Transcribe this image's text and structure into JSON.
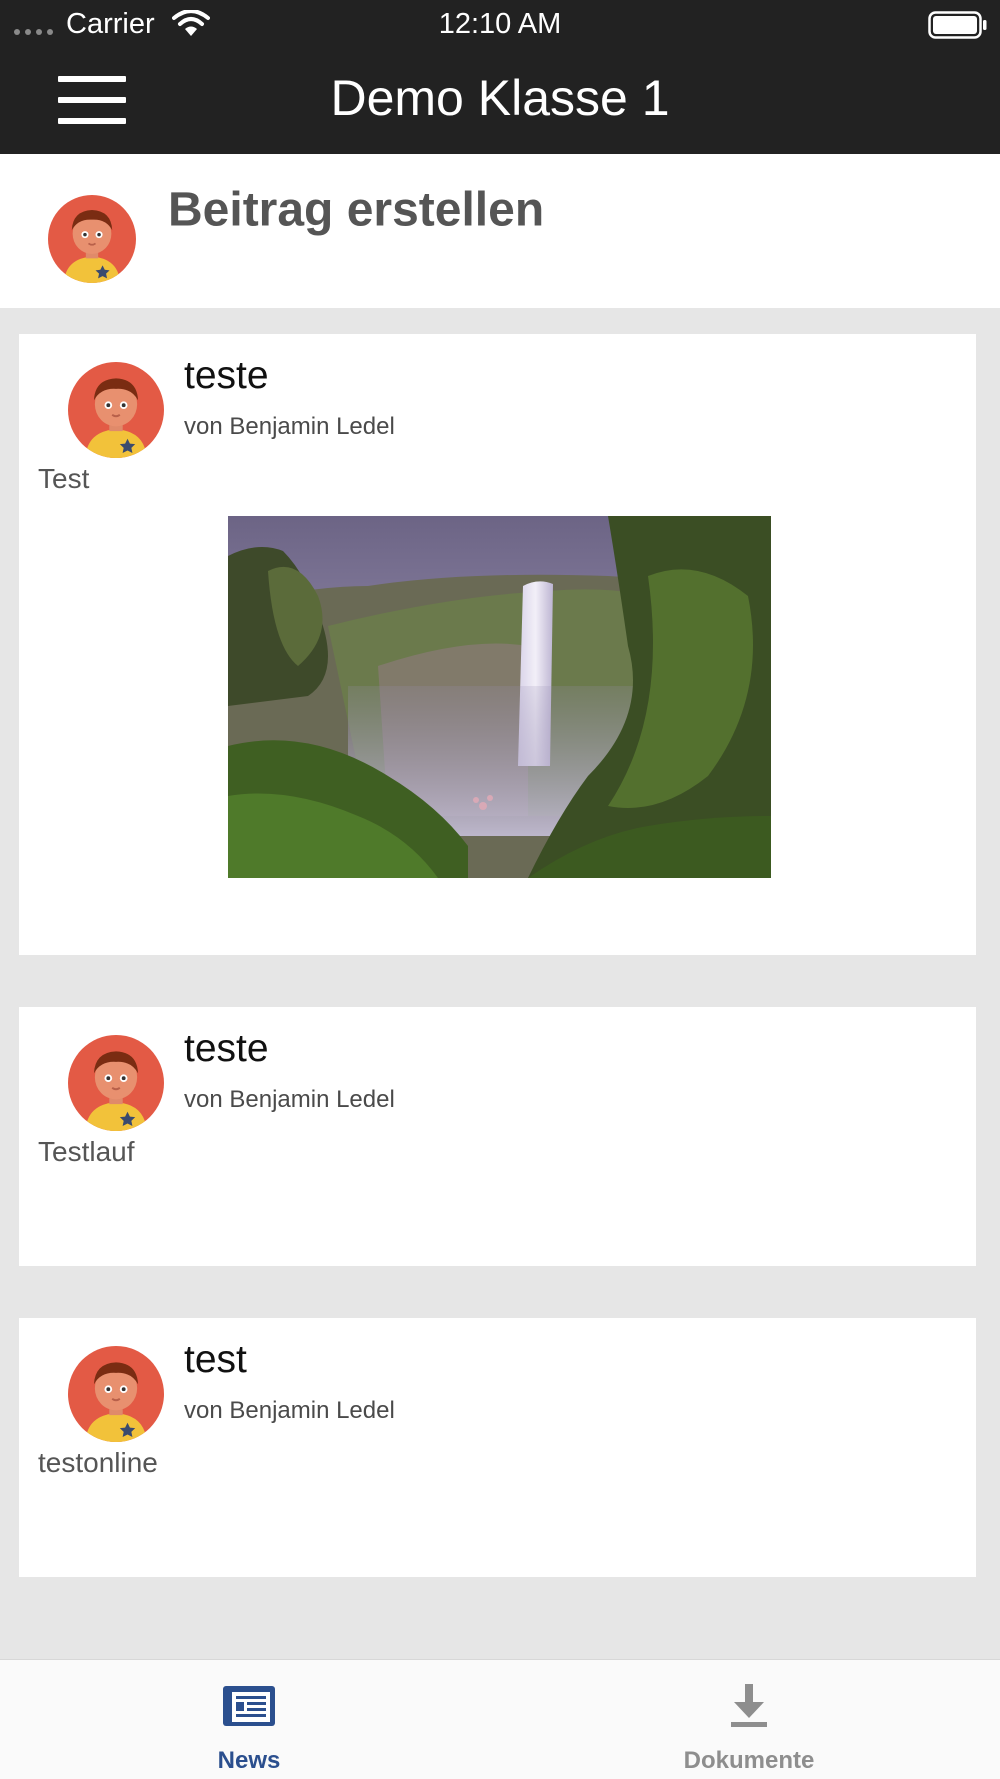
{
  "status_bar": {
    "carrier": "Carrier",
    "time": "12:10 AM"
  },
  "nav_bar": {
    "title": "Demo Klasse 1",
    "menu_icon": "hamburger-menu-icon"
  },
  "create_post": {
    "label": "Beitrag erstellen"
  },
  "posts": [
    {
      "title": "teste",
      "author": "von Benjamin Ledel",
      "body": "Test",
      "has_image": true,
      "image_subject": "waterfall photo"
    },
    {
      "title": "teste",
      "author": "von Benjamin Ledel",
      "body": "Testlauf",
      "has_image": false
    },
    {
      "title": "test",
      "author": "von Benjamin Ledel",
      "body": "testonline",
      "has_image": false
    }
  ],
  "tabs": [
    {
      "label": "News",
      "icon": "newspaper-icon",
      "active": true
    },
    {
      "label": "Dokumente",
      "icon": "download-icon",
      "active": false
    }
  ],
  "colors": {
    "nav_background": "#222222",
    "avatar_red": "#e35a45",
    "active_tab": "#2b4f8e",
    "inactive_tab": "#8e8e8e"
  }
}
